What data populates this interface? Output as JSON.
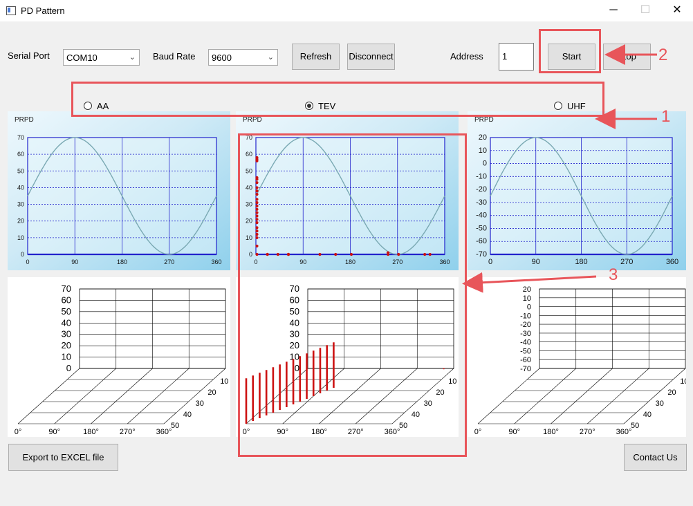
{
  "window": {
    "title": "PD Pattern",
    "minimize_icon": "─",
    "maximize_icon": "☐",
    "close_icon": "✕"
  },
  "toolbar": {
    "serial_port_label": "Serial Port",
    "serial_port_value": "COM10",
    "baud_rate_label": "Baud Rate",
    "baud_rate_value": "9600",
    "refresh_label": "Refresh",
    "disconnect_label": "Disconnect",
    "address_label": "Address",
    "address_value": "1",
    "start_label": "Start",
    "stop_label": "Stop"
  },
  "modes": {
    "selected": "TEV",
    "options": [
      "AA",
      "TEV",
      "UHF"
    ]
  },
  "footer": {
    "export_label": "Export to EXCEL file",
    "contact_label": "Contact Us"
  },
  "annotations": [
    "1",
    "2",
    "3"
  ],
  "colors": {
    "highlight": "#e8555a",
    "grid": "#2222cc",
    "sine": "#7aa9b3",
    "points": "#cc1111"
  },
  "chart_data": [
    {
      "type": "line",
      "title": "PRPD",
      "xticks": [
        "0",
        "90",
        "180",
        "270",
        "360"
      ],
      "yticks": [
        "0",
        "10",
        "20",
        "30",
        "40",
        "50",
        "60",
        "70"
      ],
      "xlim": [
        0,
        360
      ],
      "ylim": [
        0,
        70
      ]
    },
    {
      "type": "scatter",
      "title": "PRPD",
      "xticks": [
        "0",
        "90",
        "180",
        "270",
        "360"
      ],
      "yticks": [
        "0",
        "10",
        "20",
        "30",
        "40",
        "50",
        "60",
        "70"
      ],
      "xlim": [
        0,
        360
      ],
      "ylim": [
        0,
        70
      ],
      "points_x": [
        0,
        0,
        0,
        0,
        0,
        0,
        0,
        0,
        0,
        0,
        0,
        0,
        0,
        0,
        0,
        0,
        0,
        0,
        0,
        0,
        0,
        0,
        0,
        20,
        20,
        40,
        60,
        60,
        60,
        120,
        150,
        180,
        250,
        250,
        270,
        320,
        330
      ],
      "points_y": [
        58,
        57,
        56,
        46,
        45,
        43,
        40,
        38,
        36,
        33,
        31,
        29,
        27,
        25,
        23,
        21,
        19,
        16,
        14,
        12,
        10,
        5,
        0,
        0,
        0,
        0,
        0,
        0,
        0,
        0,
        0,
        0,
        0,
        1,
        0,
        0,
        0
      ]
    },
    {
      "type": "line",
      "title": "PRPD",
      "xticks": [
        "0",
        "90",
        "180",
        "270",
        "360"
      ],
      "yticks": [
        "-70",
        "-60",
        "-50",
        "-40",
        "-30",
        "-20",
        "-10",
        "0",
        "10",
        "20"
      ],
      "xlim": [
        0,
        360
      ],
      "ylim": [
        -70,
        20
      ]
    },
    {
      "type": "bar",
      "yticks": [
        "0",
        "10",
        "20",
        "30",
        "40",
        "50",
        "60",
        "70"
      ],
      "xticks": [
        "0°",
        "90°",
        "180°",
        "270°",
        "360°"
      ],
      "depth_ticks": [
        "10",
        "20",
        "30",
        "40",
        "50"
      ],
      "values": []
    },
    {
      "type": "bar",
      "yticks": [
        "0",
        "10",
        "20",
        "30",
        "40",
        "50",
        "60",
        "70"
      ],
      "xticks": [
        "0°",
        "90°",
        "180°",
        "270°",
        "360°"
      ],
      "depth_ticks": [
        "10",
        "20",
        "30",
        "40",
        "50"
      ],
      "values": [
        {
          "phase": 0,
          "value": 40
        },
        {
          "phase": 9,
          "value": 40
        },
        {
          "phase": 18,
          "value": 40
        },
        {
          "phase": 27,
          "value": 40
        },
        {
          "phase": 36,
          "value": 40
        },
        {
          "phase": 45,
          "value": 40
        },
        {
          "phase": 54,
          "value": 40
        },
        {
          "phase": 63,
          "value": 40
        },
        {
          "phase": 72,
          "value": 40
        },
        {
          "phase": 81,
          "value": 40
        },
        {
          "phase": 90,
          "value": 40
        },
        {
          "phase": 99,
          "value": 40
        },
        {
          "phase": 108,
          "value": 40
        },
        {
          "phase": 117,
          "value": 40
        },
        {
          "phase": 340,
          "value": 1
        }
      ]
    },
    {
      "type": "bar",
      "yticks": [
        "-70",
        "-60",
        "-50",
        "-40",
        "-30",
        "-20",
        "-10",
        "0",
        "10",
        "20"
      ],
      "xticks": [
        "0°",
        "90°",
        "180°",
        "270°",
        "360°"
      ],
      "depth_ticks": [
        "10",
        "20",
        "30",
        "40",
        "50"
      ],
      "values": []
    }
  ]
}
